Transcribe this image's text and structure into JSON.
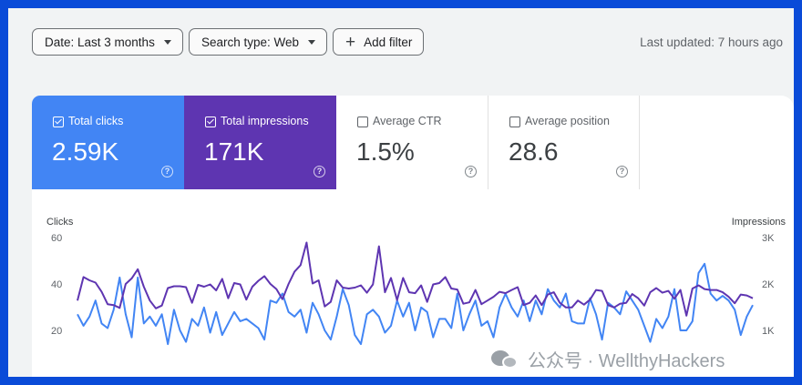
{
  "filters": {
    "date_label": "Date: Last 3 months",
    "type_label": "Search type: Web",
    "add_label": "Add filter",
    "last_updated": "Last updated: 7 hours ago"
  },
  "cards": [
    {
      "label": "Total clicks",
      "value": "2.59K",
      "checked": true
    },
    {
      "label": "Total impressions",
      "value": "171K",
      "checked": true
    },
    {
      "label": "Average CTR",
      "value": "1.5%",
      "checked": false
    },
    {
      "label": "Average position",
      "value": "28.6",
      "checked": false
    }
  ],
  "colors": {
    "clicks": "#4285f4",
    "impressions": "#5e35b1",
    "background": "#0a4bd8"
  },
  "icons": {
    "dropdown": "chevron-down-icon",
    "add": "plus-icon",
    "help": "help-circle-icon",
    "checkbox": "checkbox-icon"
  },
  "watermark": "公众号 · WellthyHackers",
  "chart_data": {
    "type": "line",
    "left_axis": {
      "label": "Clicks",
      "ticks": [
        "60",
        "40",
        "20"
      ],
      "tick_values": [
        60,
        40,
        20
      ]
    },
    "right_axis": {
      "label": "Impressions",
      "ticks": [
        "3K",
        "2K",
        "1K"
      ],
      "tick_values": [
        3000,
        2000,
        1000
      ]
    },
    "grid": false,
    "series": [
      {
        "name": "Clicks",
        "axis": "left",
        "values": [
          27,
          22,
          26,
          33,
          23,
          21,
          29,
          43,
          27,
          17,
          43,
          23,
          26,
          22,
          27,
          14,
          29,
          20,
          15,
          25,
          22,
          30,
          19,
          28,
          18,
          23,
          28,
          24,
          25,
          23,
          21,
          16,
          33,
          32,
          36,
          28,
          26,
          29,
          19,
          32,
          27,
          20,
          16,
          26,
          38,
          31,
          18,
          14,
          27,
          29,
          26,
          19,
          22,
          33,
          26,
          32,
          20,
          30,
          28,
          17,
          25,
          25,
          21,
          36,
          20,
          27,
          33,
          22,
          24,
          17,
          30,
          36,
          30,
          26,
          33,
          24,
          33,
          27,
          38,
          33,
          30,
          36,
          24,
          23,
          23,
          34,
          27,
          16,
          32,
          30,
          27,
          37,
          33,
          29,
          22,
          15,
          25,
          21,
          26,
          38,
          20,
          20,
          24,
          45,
          49,
          36,
          33,
          35,
          33,
          29,
          18,
          26,
          31
        ]
      },
      {
        "name": "Impressions",
        "axis": "right",
        "values": [
          1650,
          2160,
          2090,
          2040,
          1840,
          1570,
          1550,
          1490,
          2010,
          2130,
          2330,
          1950,
          1650,
          1480,
          1540,
          1920,
          1960,
          1960,
          1940,
          1600,
          1990,
          1950,
          2000,
          1870,
          2120,
          1700,
          2030,
          2000,
          1670,
          1950,
          2080,
          2180,
          2010,
          1900,
          1680,
          2010,
          2280,
          2420,
          2910,
          2020,
          2090,
          1520,
          1620,
          2090,
          1930,
          1910,
          1930,
          1980,
          1820,
          2000,
          2830,
          1830,
          2140,
          1660,
          2140,
          1830,
          1810,
          1980,
          1620,
          2000,
          2030,
          2160,
          1910,
          1890,
          1580,
          1610,
          1880,
          1570,
          1650,
          1730,
          1840,
          1810,
          1880,
          1940,
          1550,
          1600,
          1760,
          1550,
          1780,
          1830,
          1600,
          1500,
          1500,
          1650,
          1560,
          1670,
          1880,
          1860,
          1550,
          1500,
          1580,
          1600,
          1790,
          1700,
          1540,
          1830,
          1920,
          1820,
          1860,
          1690,
          1880,
          1320,
          1910,
          1980,
          1900,
          1880,
          1880,
          1830,
          1730,
          1590,
          1780,
          1760,
          1700
        ]
      }
    ]
  }
}
